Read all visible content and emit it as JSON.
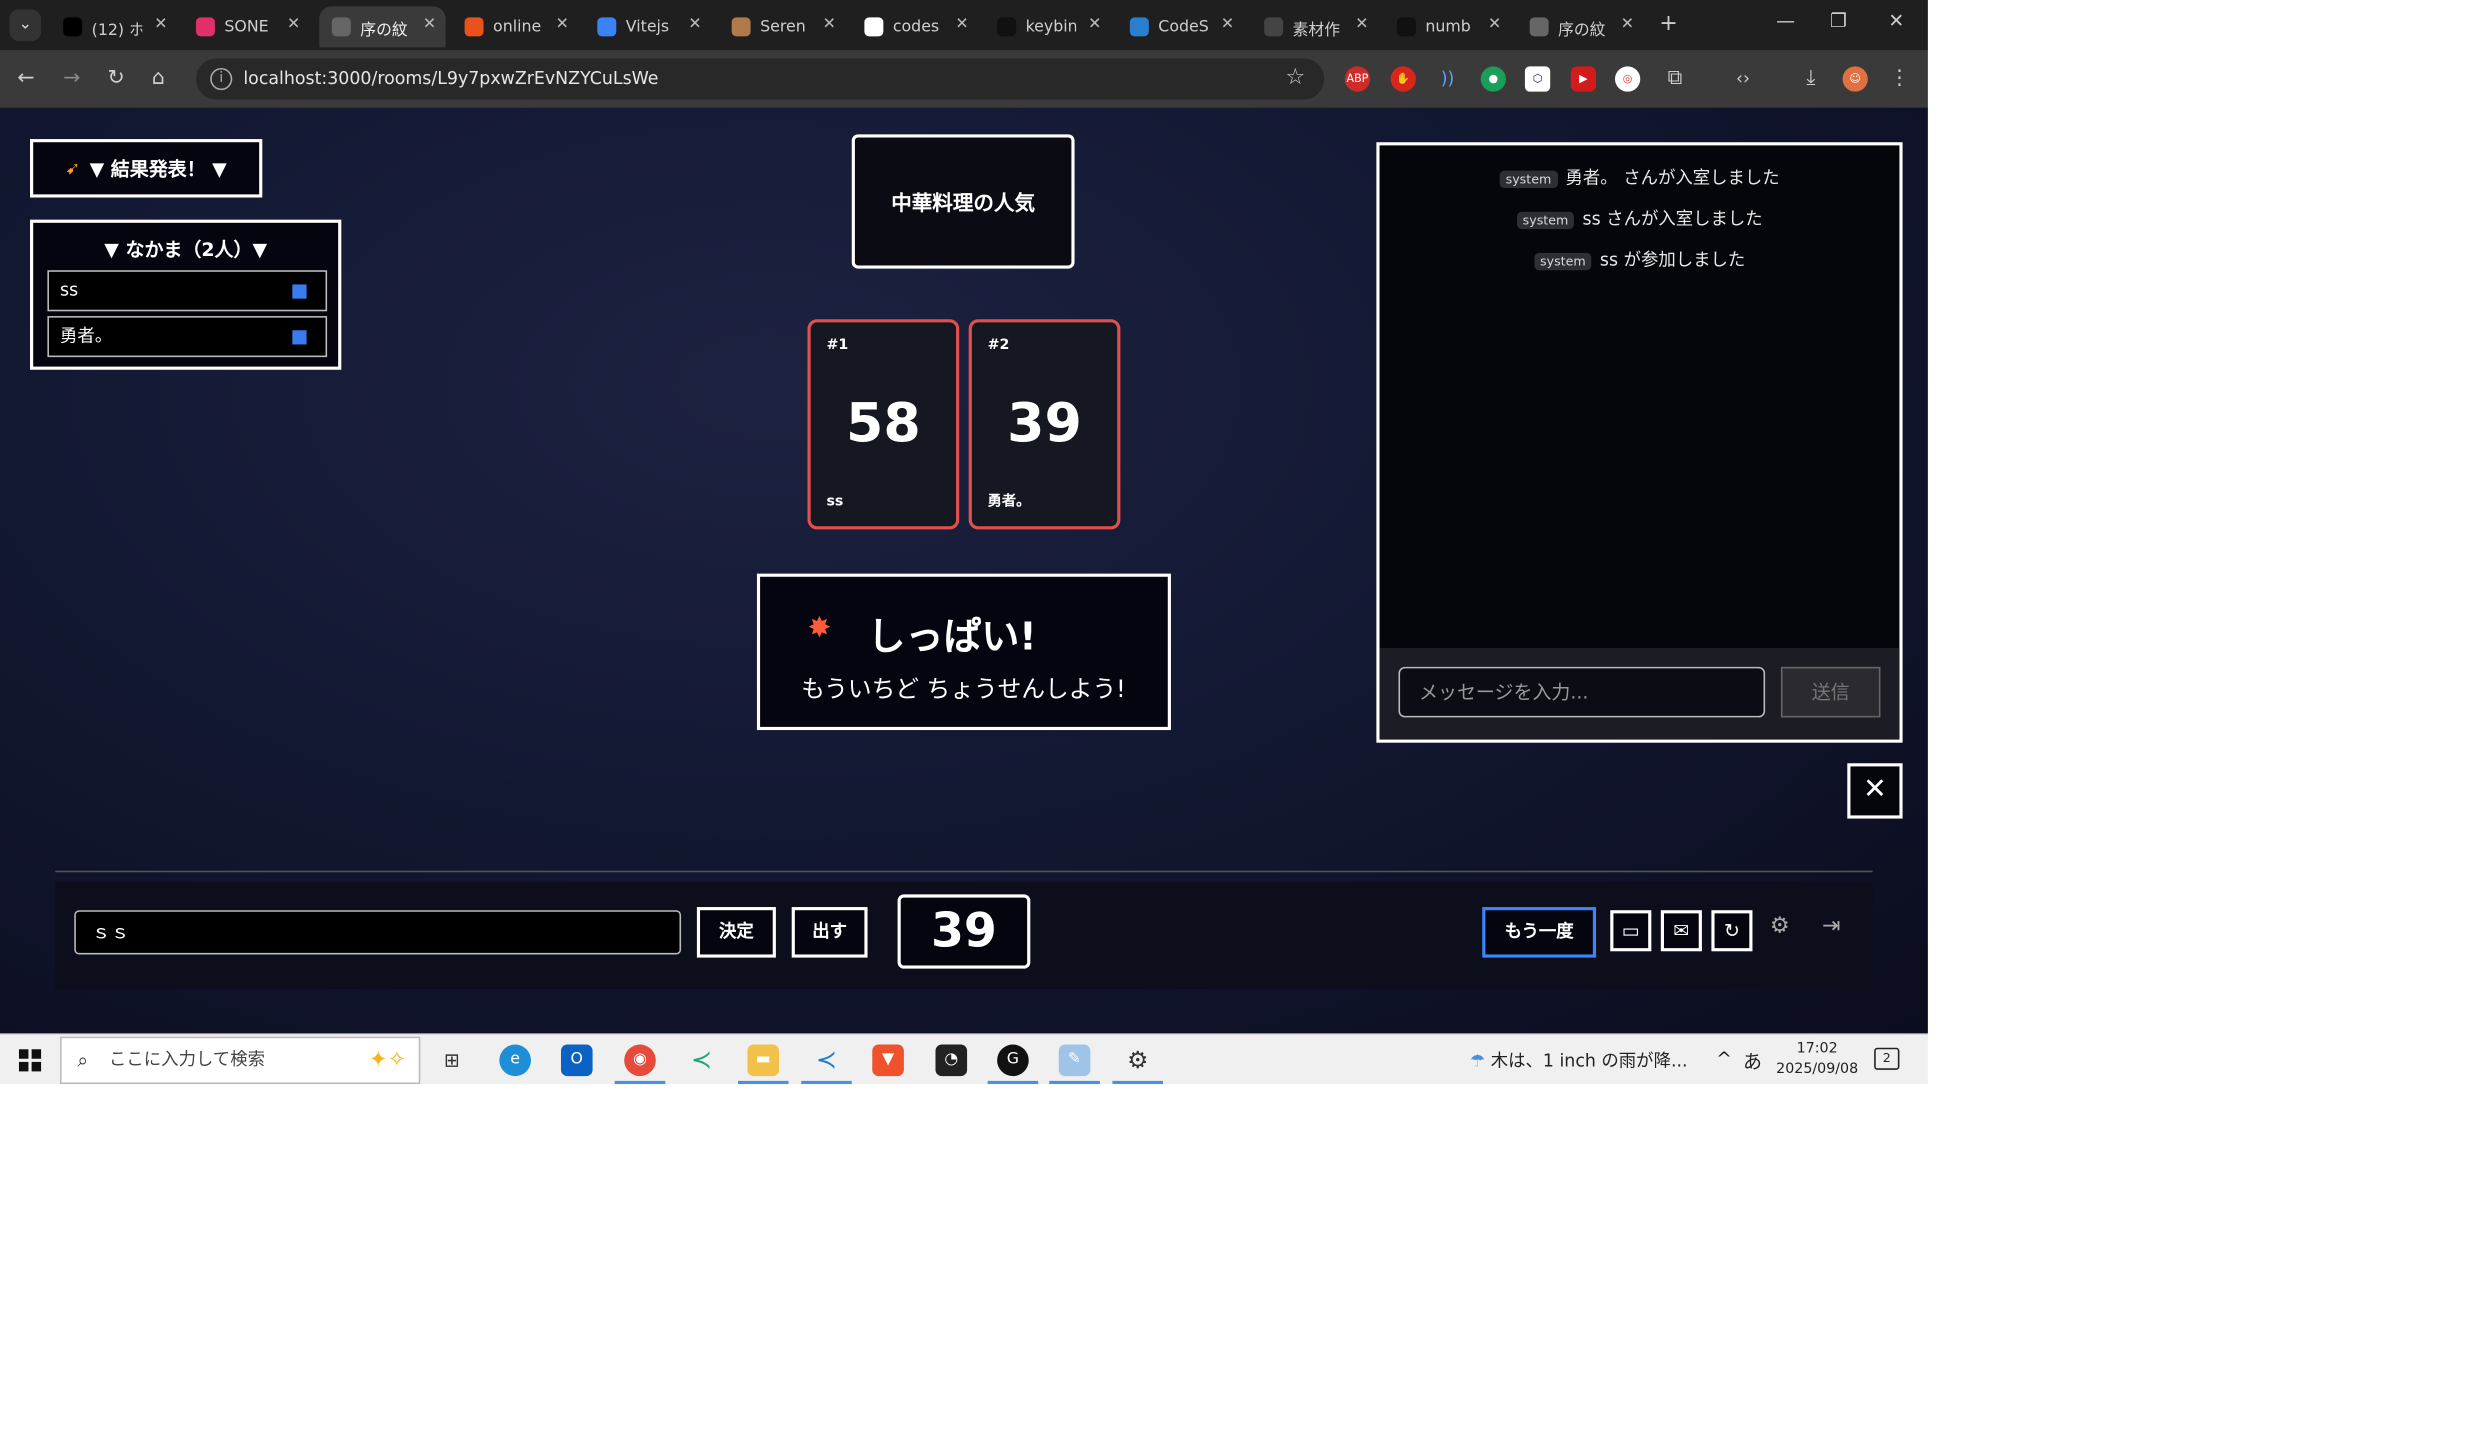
{
  "browser": {
    "tabs": [
      {
        "label": "(12) ホ",
        "favicon": "x-logo-icon",
        "color": "#000000"
      },
      {
        "label": "SONE",
        "favicon": "play-circle-icon",
        "color": "#e0306a"
      },
      {
        "label": "序の紋",
        "favicon": "app-favicon-icon",
        "color": "#666666",
        "active": true
      },
      {
        "label": "online",
        "favicon": "flame-icon",
        "color": "#e8521e"
      },
      {
        "label": "Vitejs",
        "favicon": "bolt-icon",
        "color": "#3b82f6"
      },
      {
        "label": "Seren",
        "favicon": "avatar-icon",
        "color": "#b07a4a"
      },
      {
        "label": "codes",
        "favicon": "google-icon",
        "color": "#ffffff"
      },
      {
        "label": "keybin",
        "favicon": "square-icon",
        "color": "#111111"
      },
      {
        "label": "CodeS",
        "favicon": "codesandbox-icon",
        "color": "#2a7fd0"
      },
      {
        "label": "素材作",
        "favicon": "openai-icon",
        "color": "#444444"
      },
      {
        "label": "numb",
        "favicon": "triangle-icon",
        "color": "#111111"
      },
      {
        "label": "序の紋",
        "favicon": "app-favicon-icon",
        "color": "#666666"
      }
    ],
    "url": "localhost:3000/rooms/L9y7pxwZrEvNZYCuLsWe"
  },
  "app": {
    "result_button": "▼ 結果発表！ ▼",
    "party": {
      "title": "▼ なかま（2人）▼",
      "members": [
        "ss",
        "勇者。"
      ]
    },
    "theme": "中華料理の人気",
    "cards": [
      {
        "index": "#1",
        "value": "58",
        "name": "ss"
      },
      {
        "index": "#2",
        "value": "39",
        "name": "勇者。"
      }
    ],
    "result": {
      "title": "しっぱい!",
      "subtitle": "もういちど ちょうせんしよう!"
    },
    "chat": {
      "tag": "system",
      "messages": [
        "勇者。 さんが入室しました",
        "ss さんが入室しました",
        "ss が参加しました"
      ],
      "placeholder": "メッセージを入力...",
      "send_label": "送信"
    },
    "controls": {
      "name_value": "ｓｓ",
      "decide_label": "決定",
      "submit_label": "出す",
      "my_number": "39",
      "again_label": "もう一度"
    },
    "accent_color": "#3a86ff",
    "card_border_color": "#e0504f"
  },
  "taskbar": {
    "search_placeholder": "ここに入力して検索",
    "weather": "木は、1 inch の雨が降...",
    "ime": "あ",
    "time": "17:02",
    "date": "2025/09/08",
    "notifications": "2"
  }
}
